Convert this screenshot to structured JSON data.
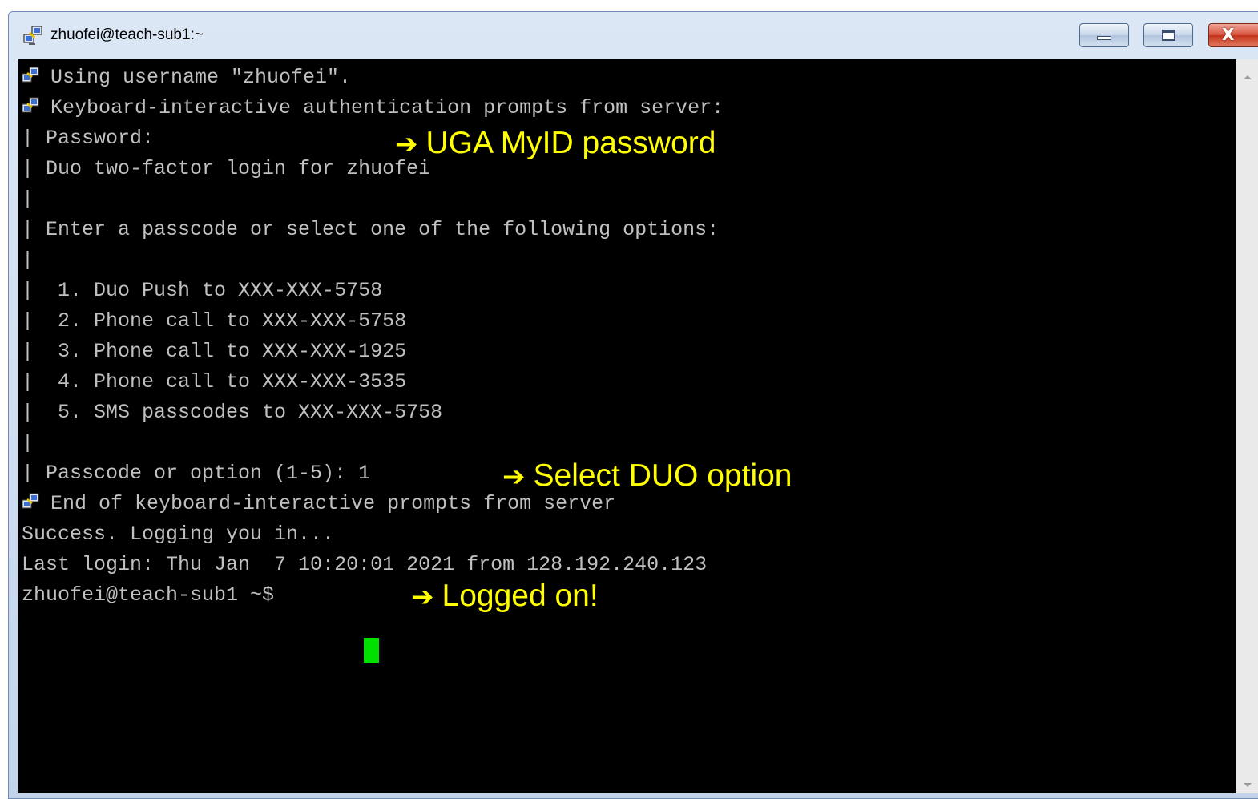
{
  "window": {
    "title": "zhuofei@teach-sub1:~",
    "title_icon": "putty-icon",
    "buttons": {
      "minimize_icon": "minimize-icon",
      "maximize_icon": "maximize-icon",
      "close_icon": "close-icon",
      "close_glyph": "X"
    }
  },
  "terminal": {
    "colors": {
      "background": "#000000",
      "text": "#c0c0c0",
      "cursor": "#00e000",
      "annotation": "#ffff00"
    },
    "lines": [
      {
        "icon": "putty-icon",
        "text": "Using username \"zhuofei\"."
      },
      {
        "icon": "putty-icon",
        "text": "Keyboard-interactive authentication prompts from server:"
      },
      {
        "text": "| Password:"
      },
      {
        "text": "| Duo two-factor login for zhuofei"
      },
      {
        "text": "|"
      },
      {
        "text": "| Enter a passcode or select one of the following options:"
      },
      {
        "text": "|"
      },
      {
        "text": "|  1. Duo Push to XXX-XXX-5758"
      },
      {
        "text": "|  2. Phone call to XXX-XXX-5758"
      },
      {
        "text": "|  3. Phone call to XXX-XXX-1925"
      },
      {
        "text": "|  4. Phone call to XXX-XXX-3535"
      },
      {
        "text": "|  5. SMS passcodes to XXX-XXX-5758"
      },
      {
        "text": "|"
      },
      {
        "text": "| Passcode or option (1-5): 1"
      },
      {
        "icon": "putty-icon",
        "text": "End of keyboard-interactive prompts from server"
      },
      {
        "text": "Success. Logging you in..."
      },
      {
        "text": "Last login: Thu Jan  7 10:20:01 2021 from 128.192.240.123"
      },
      {
        "text": "zhuofei@teach-sub1 ~$ "
      }
    ]
  },
  "annotations": {
    "arrow_glyph": "➔",
    "password": "UGA MyID password",
    "duo_option": "Select DUO option",
    "logged_on": "Logged on!"
  }
}
